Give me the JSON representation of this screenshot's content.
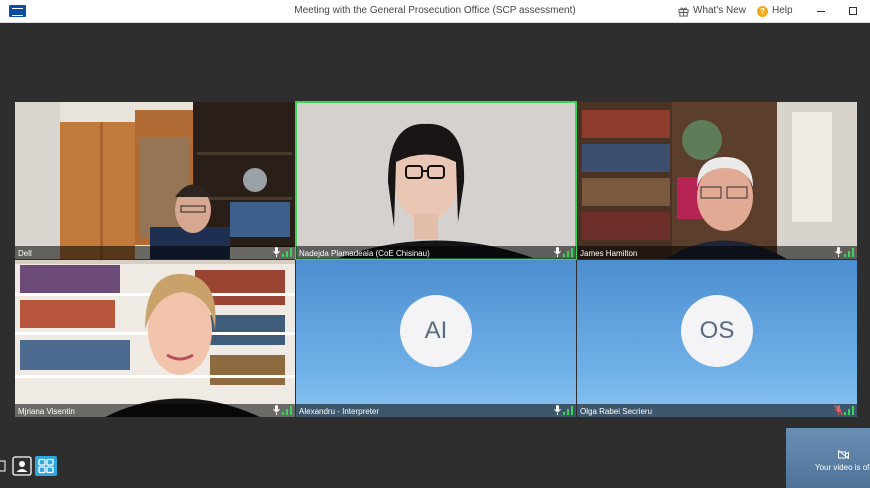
{
  "window": {
    "title": "Meeting with the General Prosecution Office (SCP assessment)",
    "whats_new": "What's New",
    "help": "Help"
  },
  "participants": [
    {
      "name": "Dell",
      "type": "video",
      "active": false
    },
    {
      "name": "Nadejda Plamadeala (CoE Chisinau)",
      "type": "video",
      "active": true
    },
    {
      "name": "James Hamilton",
      "type": "video",
      "active": false
    },
    {
      "name": "Mjriana Visentin",
      "type": "video",
      "active": false
    },
    {
      "name": "Alexandru - Interpreter",
      "type": "avatar",
      "initials": "AI",
      "active": false
    },
    {
      "name": "Olga Rabei Secrieru",
      "type": "avatar",
      "initials": "OS",
      "active": false,
      "muted": true
    }
  ],
  "self_view": {
    "status": "Your video is of"
  },
  "colors": {
    "active_border": "#3dd15a",
    "signal_green": "#3dd15a",
    "brand_blue": "#0b4ea2",
    "grid_view_active": "#2ea9e0"
  },
  "icons": {
    "logo": "coe-flag-icon",
    "whats_new": "gift-icon",
    "help": "help-icon",
    "mic": "microphone-icon",
    "signal": "signal-strength-icon",
    "camera_off": "camera-off-icon"
  }
}
